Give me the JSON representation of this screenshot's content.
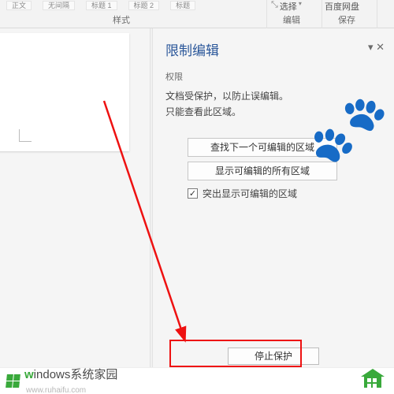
{
  "ribbon": {
    "style_chips": [
      "正文",
      "无间隔",
      "标题 1",
      "标题 2",
      "标题"
    ],
    "group_styles": "样式",
    "select_button": "选择",
    "group_edit": "编辑",
    "save_button": "百度网盘",
    "group_save": "保存"
  },
  "pane": {
    "title": "限制编辑",
    "section_label": "权限",
    "body_line1": "文档受保护，以防止误编辑。",
    "body_line2": "只能查看此区域。",
    "btn_find_next": "查找下一个可编辑的区域",
    "btn_show_all": "显示可编辑的所有区域",
    "chk_highlight": "突出显示可编辑的区域",
    "stop_protect": "停止保护"
  },
  "watermark": {
    "brand_colored": "w",
    "brand_rest": "indows系统家园",
    "sub": "www.ruhaifu.com"
  }
}
